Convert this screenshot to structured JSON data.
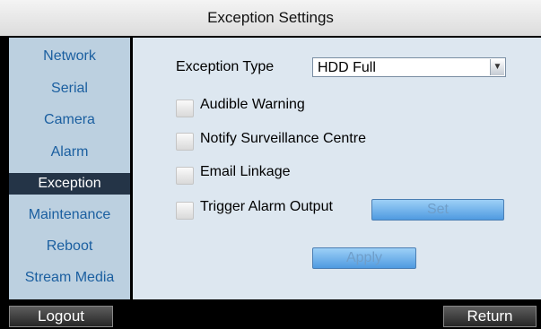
{
  "window": {
    "title": "Exception Settings"
  },
  "sidebar": {
    "items": [
      {
        "label": "Network"
      },
      {
        "label": "Serial"
      },
      {
        "label": "Camera"
      },
      {
        "label": "Alarm"
      },
      {
        "label": "Exception",
        "active": true
      },
      {
        "label": "Maintenance"
      },
      {
        "label": "Reboot"
      },
      {
        "label": "Stream Media"
      }
    ]
  },
  "exception": {
    "type_label": "Exception Type",
    "type_value": "HDD Full",
    "options": [
      {
        "label": "Audible Warning",
        "checked": false
      },
      {
        "label": "Notify Surveillance Centre",
        "checked": false
      },
      {
        "label": "Email Linkage",
        "checked": false
      },
      {
        "label": "Trigger Alarm Output",
        "checked": false
      }
    ],
    "set_label": "Set",
    "apply_label": "Apply"
  },
  "bottom": {
    "logout_label": "Logout",
    "return_label": "Return"
  },
  "colors": {
    "active_menu_bg": "#243447",
    "menu_text": "#1b5fa0",
    "button_blue": "#6aaeea"
  }
}
